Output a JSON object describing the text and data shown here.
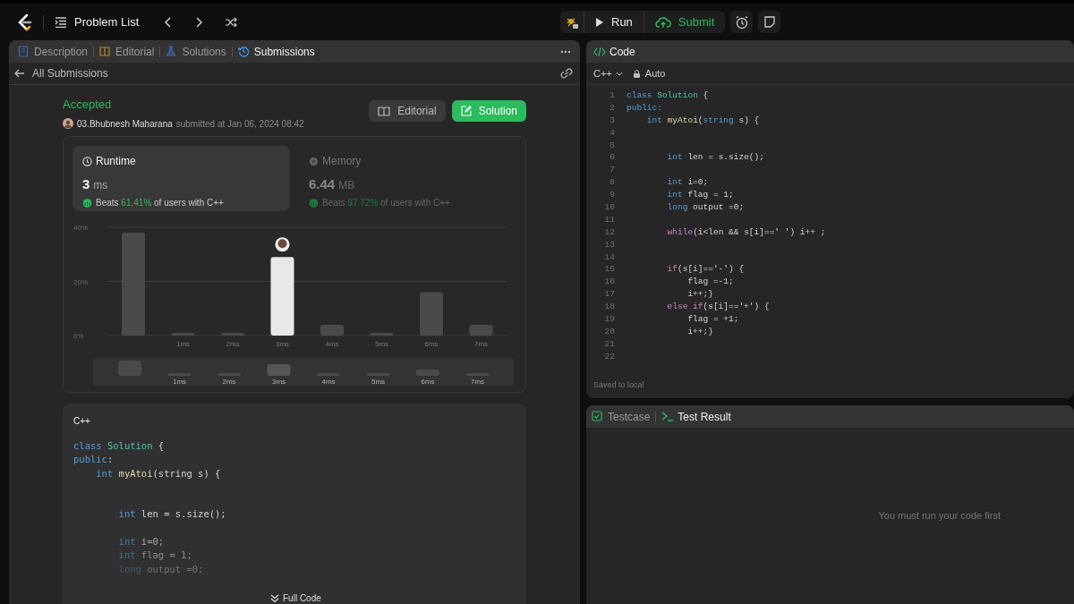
{
  "top_bar": {
    "problem_list": "Problem List",
    "run": "Run",
    "submit": "Submit"
  },
  "left_panel": {
    "tabs": [
      {
        "label": "Description",
        "selected": false
      },
      {
        "label": "Editorial",
        "selected": false
      },
      {
        "label": "Solutions",
        "selected": false
      },
      {
        "label": "Submissions",
        "selected": true
      }
    ],
    "back_link": "All Submissions",
    "submission": {
      "status": "Accepted",
      "user": "03.Bhubnesh Maharana",
      "submitted": "submitted at Jan 06, 2024 08:42",
      "buttons": [
        {
          "kind": "secondary",
          "label": "Editorial"
        },
        {
          "kind": "primary",
          "label": "Solution"
        }
      ]
    },
    "stats": [
      {
        "title": "Runtime",
        "value": "3",
        "unit": "ms",
        "beats_prefix": "Beats",
        "beats": "61.41%",
        "beats_suffix": "of users with C++",
        "selected": true
      },
      {
        "title": "Memory",
        "value": "6.44",
        "unit": "MB",
        "beats_prefix": "Beats",
        "beats": "97.72%",
        "beats_suffix": "of users with C++",
        "selected": false
      }
    ],
    "chart_data": {
      "type": "bar",
      "categories": [
        null,
        "1ms",
        "2ms",
        "3ms",
        "4ms",
        "5ms",
        "6ms",
        "7ms"
      ],
      "series": [
        {
          "color": "#4a4a4a",
          "values": [
            38,
            1,
            1,
            null,
            4,
            1,
            16,
            4
          ]
        },
        {
          "color": "#e8e8e8",
          "values": [
            null,
            null,
            null,
            29,
            null,
            null,
            null,
            null
          ]
        }
      ],
      "ylim": [
        0,
        40
      ],
      "yticks": [
        {
          "value": 0,
          "label": "0%"
        },
        {
          "value": 20,
          "label": "20%"
        },
        {
          "value": 40,
          "label": "40%"
        }
      ]
    },
    "overview_labels": [
      "1ms",
      "2ms",
      "3ms",
      "4ms",
      "5ms",
      "6ms",
      "7ms"
    ],
    "code_preview": {
      "language": "C++",
      "expand": "Full Code",
      "lines": [
        {
          "kind": "code",
          "tokens": [
            {
              "kind": "kw",
              "text": "class "
            },
            {
              "kind": "cls",
              "text": "Solution"
            },
            {
              "kind": "plain",
              "text": " {"
            }
          ]
        },
        {
          "kind": "code",
          "tokens": [
            {
              "kind": "kw",
              "text": "public"
            },
            {
              "kind": "plain",
              "text": ":"
            }
          ]
        },
        {
          "kind": "code",
          "tokens": [
            {
              "kind": "kw",
              "text": "    int"
            },
            {
              "kind": "fn",
              "text": " myAtoi"
            },
            {
              "kind": "plain",
              "text": "(string s) {"
            }
          ]
        },
        {
          "kind": "blank"
        },
        {
          "kind": "blank"
        },
        {
          "kind": "code",
          "tokens": [
            {
              "kind": "kw",
              "text": "        int"
            },
            {
              "kind": "plain",
              "text": " len = s.size();"
            }
          ]
        },
        {
          "kind": "blank"
        },
        {
          "kind": "code",
          "tokens": [
            {
              "kind": "kw",
              "text": "        int"
            },
            {
              "kind": "plain",
              "text": " i=0;"
            }
          ]
        },
        {
          "kind": "code",
          "tokens": [
            {
              "kind": "kw",
              "text": "        int"
            },
            {
              "kind": "plain",
              "text": " flag = 1;"
            }
          ]
        },
        {
          "kind": "code",
          "tokens": [
            {
              "kind": "kw",
              "text": "        long"
            },
            {
              "kind": "plain",
              "text": " output =0;"
            }
          ]
        }
      ]
    }
  },
  "code_panel": {
    "title": "Code",
    "language": "C++",
    "mode": "Auto",
    "saved": "Saved to local",
    "lines": [
      {
        "number": "1",
        "tokens": [
          {
            "kind": "kw",
            "text": "class "
          },
          {
            "kind": "cls",
            "text": "Solution"
          },
          {
            "kind": "plain",
            "text": " {"
          }
        ]
      },
      {
        "number": "2",
        "tokens": [
          {
            "kind": "kw",
            "text": "public:"
          }
        ]
      },
      {
        "number": "3",
        "tokens": [
          {
            "kind": "kw",
            "text": "    int"
          },
          {
            "kind": "fn",
            "text": " myAtoi"
          },
          {
            "kind": "plain",
            "text": "("
          },
          {
            "kind": "kw",
            "text": "string"
          },
          {
            "kind": "plain",
            "text": " s) {"
          }
        ]
      },
      {
        "number": "4"
      },
      {
        "number": "5"
      },
      {
        "number": "6",
        "tokens": [
          {
            "kind": "kw",
            "text": "        int"
          },
          {
            "kind": "plain",
            "text": " len = s.size();"
          }
        ]
      },
      {
        "number": "7"
      },
      {
        "number": "8",
        "tokens": [
          {
            "kind": "kw",
            "text": "        int"
          },
          {
            "kind": "plain",
            "text": " i=0;"
          }
        ]
      },
      {
        "number": "9",
        "tokens": [
          {
            "kind": "kw",
            "text": "        int"
          },
          {
            "kind": "plain",
            "text": " flag = 1;"
          }
        ]
      },
      {
        "number": "10",
        "tokens": [
          {
            "kind": "kw",
            "text": "        long"
          },
          {
            "kind": "plain",
            "text": " output =0;"
          }
        ]
      },
      {
        "number": "11"
      },
      {
        "number": "12",
        "tokens": [
          {
            "kind": "ctl",
            "text": "        while"
          },
          {
            "kind": "plain",
            "text": "(i<len && s[i]==' ') i++ ;"
          }
        ]
      },
      {
        "number": "13"
      },
      {
        "number": "14"
      },
      {
        "number": "15",
        "tokens": [
          {
            "kind": "ctl",
            "text": "        if"
          },
          {
            "kind": "plain",
            "text": "(s[i]=='-') {"
          }
        ]
      },
      {
        "number": "16",
        "tokens": [
          {
            "kind": "plain",
            "text": "            flag =-1;"
          }
        ]
      },
      {
        "number": "17",
        "tokens": [
          {
            "kind": "plain",
            "text": "            i++;}"
          }
        ]
      },
      {
        "number": "18",
        "tokens": [
          {
            "kind": "ctl",
            "text": "        else if"
          },
          {
            "kind": "plain",
            "text": "(s[i]=='+') {"
          }
        ]
      },
      {
        "number": "19",
        "tokens": [
          {
            "kind": "plain",
            "text": "            flag = +1;"
          }
        ]
      },
      {
        "number": "20",
        "tokens": [
          {
            "kind": "plain",
            "text": "            i++;}"
          }
        ]
      },
      {
        "number": "21"
      },
      {
        "number": "22"
      }
    ]
  },
  "test_panel": {
    "tabs": [
      {
        "label": "Testcase",
        "selected": false
      },
      {
        "label": "Test Result",
        "selected": true
      }
    ],
    "message": "You must run your code first"
  }
}
